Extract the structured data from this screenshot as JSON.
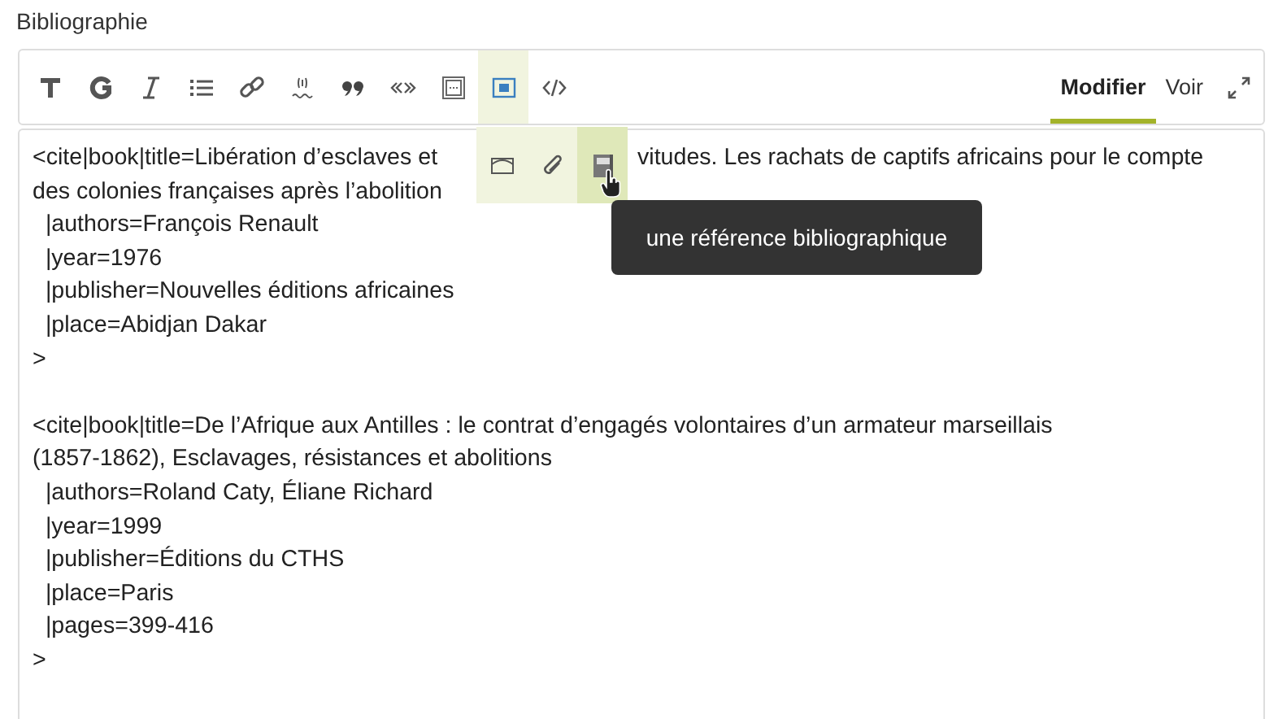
{
  "label": "Bibliographie",
  "toolbar": {
    "buttons": [
      {
        "kind": "heading",
        "selected": false
      },
      {
        "kind": "bold",
        "selected": false
      },
      {
        "kind": "italic",
        "selected": false
      },
      {
        "kind": "list",
        "selected": false
      },
      {
        "kind": "link",
        "selected": false
      },
      {
        "kind": "footnote",
        "selected": false
      },
      {
        "kind": "quote",
        "selected": false
      },
      {
        "kind": "inline-quote",
        "selected": false
      },
      {
        "kind": "frame",
        "selected": false
      },
      {
        "kind": "insert",
        "selected": true
      },
      {
        "kind": "code",
        "selected": false
      }
    ],
    "tabs": [
      {
        "label": "Modifier",
        "selected": true
      },
      {
        "label": "Voir",
        "selected": false
      }
    ]
  },
  "popup": {
    "buttons": [
      {
        "kind": "image",
        "selected": false
      },
      {
        "kind": "attachment",
        "selected": false
      },
      {
        "kind": "reference",
        "selected": true
      }
    ]
  },
  "tooltip": "une référence bibliographique",
  "editor": {
    "blocks": [
      {
        "lines": [
          {
            "text": "<cite|book|title=Libération d’esclaves et",
            "after": "vitudes. Les rachats de captifs africains pour le compte"
          },
          {
            "text": "des colonies françaises après l’abolition"
          },
          {
            "text": "  |authors=François Renault"
          },
          {
            "text": "  |year=1976"
          },
          {
            "text": "  |publisher=Nouvelles éditions africaines"
          },
          {
            "text": "  |place=Abidjan Dakar"
          },
          {
            "text": ">"
          }
        ]
      },
      {
        "lines": [
          {
            "text": "<cite|book|title=De l’Afrique aux Antilles : le contrat d’engagés volontaires d’un armateur marseillais"
          },
          {
            "text": "(1857-1862), Esclavages, résistances et abolitions"
          },
          {
            "text": "  |authors=Roland Caty, Éliane Richard"
          },
          {
            "text": "  |year=1999"
          },
          {
            "text": "  |publisher=Éditions du CTHS"
          },
          {
            "text": "  |place=Paris"
          },
          {
            "text": "  |pages=399-416"
          },
          {
            "text": ">"
          }
        ]
      }
    ]
  }
}
